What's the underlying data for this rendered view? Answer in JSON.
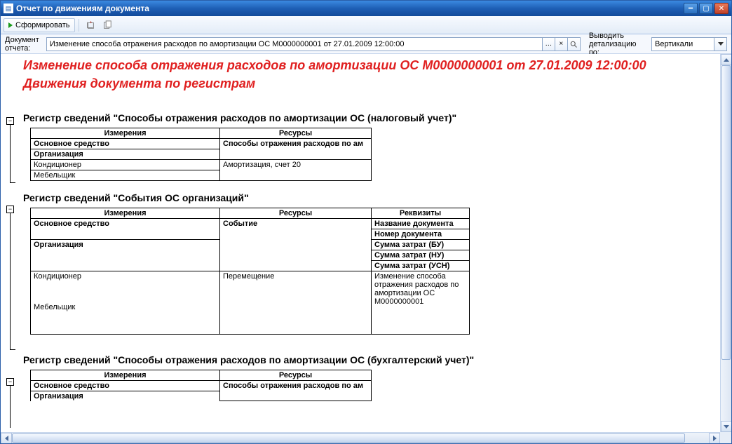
{
  "window_title": "Отчет по движениям документа",
  "toolbar": {
    "run_label": "Сформировать"
  },
  "filter": {
    "doc_label": "Документ отчета:",
    "doc_value": "Изменение способа отражения расходов по амортизации ОС М0000000001 от 27.01.2009 12:00:00",
    "detail_label": "Выводить детализацию по:",
    "detail_value": "Вертикали"
  },
  "report": {
    "title": "Изменение способа отражения расходов по амортизации ОС М0000000001 от 27.01.2009 12:00:00",
    "subtitle": "Движения документа по регистрам",
    "heading_col_dimensions": "Измерения",
    "heading_col_resources": "Ресурсы",
    "heading_col_details": "Реквизиты",
    "sections": [
      {
        "title": "Регистр сведений \"Способы отражения расходов по амортизации ОС (налоговый учет)\"",
        "dim_rows": [
          "Основное средство",
          "Организация"
        ],
        "res_rows": [
          "Способы отражения расходов по ам"
        ],
        "data_dim": [
          "Кондиционер",
          "Мебельщик"
        ],
        "data_res": [
          "Амортизация, счет 20"
        ]
      },
      {
        "title": "Регистр сведений \"События ОС организаций\"",
        "dim_rows": [
          "Основное средство",
          "Организация"
        ],
        "res_rows": [
          "Событие"
        ],
        "det_rows": [
          "Название документа",
          "Номер документа",
          "Сумма затрат (БУ)",
          "Сумма затрат (НУ)",
          "Сумма затрат (УСН)"
        ],
        "data_dim": [
          "Кондиционер",
          "Мебельщик"
        ],
        "data_res": [
          "Перемещение"
        ],
        "data_det": [
          "Изменение способа отражения расходов по амортизации ОС М0000000001"
        ]
      },
      {
        "title": "Регистр сведений \"Способы отражения расходов по амортизации ОС (бухгалтерский учет)\"",
        "dim_rows": [
          "Основное средство",
          "Организация"
        ],
        "res_rows": [
          "Способы отражения расходов по ам"
        ]
      }
    ]
  }
}
